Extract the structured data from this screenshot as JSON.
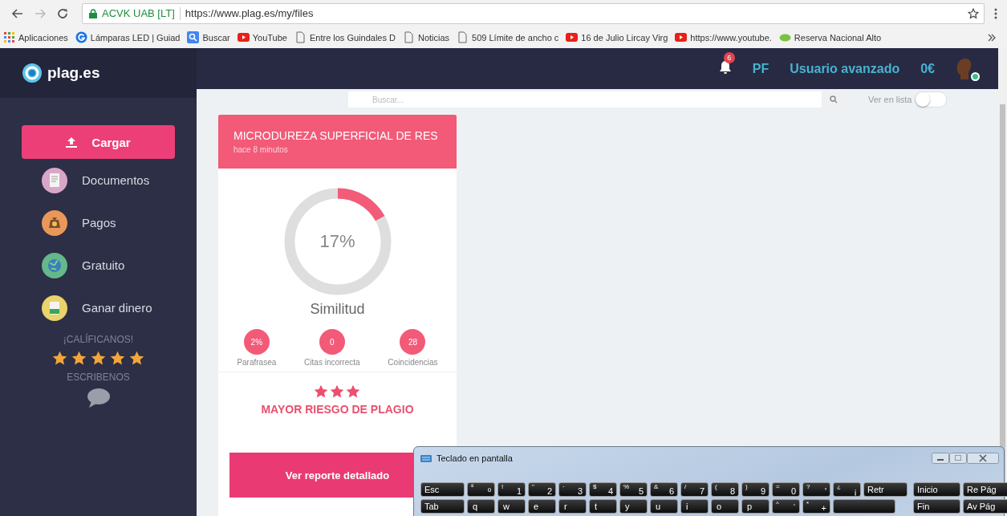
{
  "browser": {
    "forward_disabled": true,
    "site_identity": "ACVK UAB [LT]",
    "url": "https://www.plag.es/my/files",
    "bookmarks": [
      {
        "label": "Aplicaciones",
        "kind": "apps"
      },
      {
        "label": "Lámparas LED | Guiad",
        "kind": "g"
      },
      {
        "label": "Buscar",
        "kind": "search"
      },
      {
        "label": "YouTube",
        "kind": "video"
      },
      {
        "label": "Entre los Guindales D",
        "kind": "page"
      },
      {
        "label": "Noticias",
        "kind": "page"
      },
      {
        "label": "509 Límite de ancho c",
        "kind": "page"
      },
      {
        "label": "16 de Julio Lircay Virg",
        "kind": "video"
      },
      {
        "label": "https://www.youtube.",
        "kind": "video"
      },
      {
        "label": "Reserva Nacional Alto",
        "kind": "leaf"
      }
    ]
  },
  "sidebar": {
    "logo": "plag.es",
    "upload_button": "Cargar",
    "items": [
      {
        "label": "Documentos",
        "kind": "document"
      },
      {
        "label": "Pagos",
        "kind": "money"
      },
      {
        "label": "Gratuito",
        "kind": "globe"
      },
      {
        "label": "Ganar dinero",
        "kind": "cash"
      }
    ],
    "rate_label": "¡CALÍFICANOS!",
    "rating": {
      "stars": 5
    },
    "write_label": "ESCRIBENOS"
  },
  "header": {
    "notification_count": "6",
    "initials": "PF",
    "plan": "Usuario avanzado",
    "balance": "0€",
    "online": true
  },
  "search": {
    "placeholder": "Buscar..."
  },
  "list_toggle": {
    "label": "Ver en lista",
    "on": false
  },
  "card": {
    "title": "MICRODUREZA SUPERFICIAL DE RES",
    "time": "hace 8 minutos",
    "similarity": {
      "level": 0.17,
      "reading": "17%",
      "label": "Similitud"
    },
    "stats": [
      {
        "value": "2%",
        "label": "Parafrasea"
      },
      {
        "value": "0",
        "label": "Citas incorrecta"
      },
      {
        "value": "28",
        "label": "Coincidencias"
      }
    ],
    "risk": {
      "stars": 3,
      "label": "MAYOR RIESGO DE PLAGIO"
    },
    "button": "Ver reporte detallado"
  },
  "keyboard": {
    "title": "Teclado en pantalla",
    "main_rows": [
      [
        {
          "kind": "wide",
          "main": "Esc"
        },
        {
          "kind": "dual",
          "top": "ª",
          "main": "º"
        },
        {
          "kind": "dual",
          "top": "!",
          "main": "1"
        },
        {
          "kind": "dual",
          "top": "\"",
          "main": "2"
        },
        {
          "kind": "dual",
          "top": "·",
          "main": "3"
        },
        {
          "kind": "dual",
          "top": "$",
          "main": "4"
        },
        {
          "kind": "dual",
          "top": "%",
          "main": "5"
        },
        {
          "kind": "dual",
          "top": "&",
          "main": "6"
        },
        {
          "kind": "dual",
          "top": "/",
          "main": "7"
        },
        {
          "kind": "dual",
          "top": "(",
          "main": "8"
        },
        {
          "kind": "dual",
          "top": ")",
          "main": "9"
        },
        {
          "kind": "dual",
          "top": "=",
          "main": "0"
        },
        {
          "kind": "dual",
          "top": "?",
          "main": "'"
        },
        {
          "kind": "dual",
          "top": "¿",
          "main": "¡"
        },
        {
          "kind": "wide",
          "main": "Retr"
        }
      ],
      [
        {
          "kind": "wide",
          "main": "Tab"
        },
        {
          "kind": "char",
          "main": "q"
        },
        {
          "kind": "char",
          "main": "w"
        },
        {
          "kind": "char",
          "main": "e"
        },
        {
          "kind": "char",
          "main": "r"
        },
        {
          "kind": "char",
          "main": "t"
        },
        {
          "kind": "char",
          "main": "y"
        },
        {
          "kind": "char",
          "main": "u"
        },
        {
          "kind": "char",
          "main": "i"
        },
        {
          "kind": "char",
          "main": "o"
        },
        {
          "kind": "char",
          "main": "p"
        },
        {
          "kind": "dual",
          "top": "^",
          "main": "`"
        },
        {
          "kind": "dual",
          "top": "*",
          "main": "+"
        },
        {
          "kind": "blank"
        }
      ]
    ],
    "nav_rows": [
      [
        {
          "kind": "nav",
          "main": "Inicio"
        },
        {
          "kind": "nav",
          "main": "Re Pág"
        }
      ],
      [
        {
          "kind": "nav",
          "main": "Fin"
        },
        {
          "kind": "nav",
          "main": "Av Pág"
        }
      ]
    ]
  }
}
